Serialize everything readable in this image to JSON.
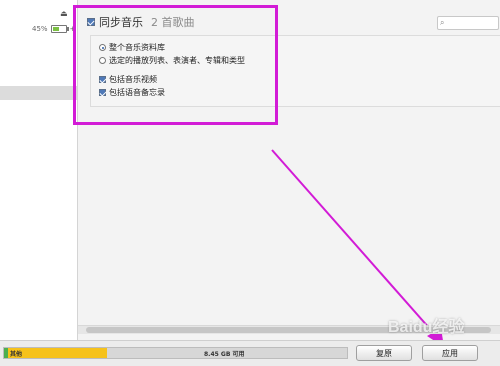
{
  "sidebar": {
    "eject_icon": "eject-icon",
    "battery": {
      "percent_text": "45%",
      "level": 45
    }
  },
  "sync": {
    "title": "同步音乐",
    "count": "2 首歌曲",
    "checked": true,
    "options": {
      "entire_library": "整个音乐资料库",
      "selected": "选定的播放列表、表演者、专辑和类型",
      "include_videos": "包括音乐视频",
      "include_voice_memos": "包括语音备忘录"
    }
  },
  "storage": {
    "other_label": "其他",
    "free_label": "8.45 GB 可用"
  },
  "buttons": {
    "revert": "复原",
    "apply": "应用"
  },
  "watermark": "Baidu经验",
  "colors": {
    "highlight": "#d21bd6",
    "accent": "#4f79b8"
  }
}
